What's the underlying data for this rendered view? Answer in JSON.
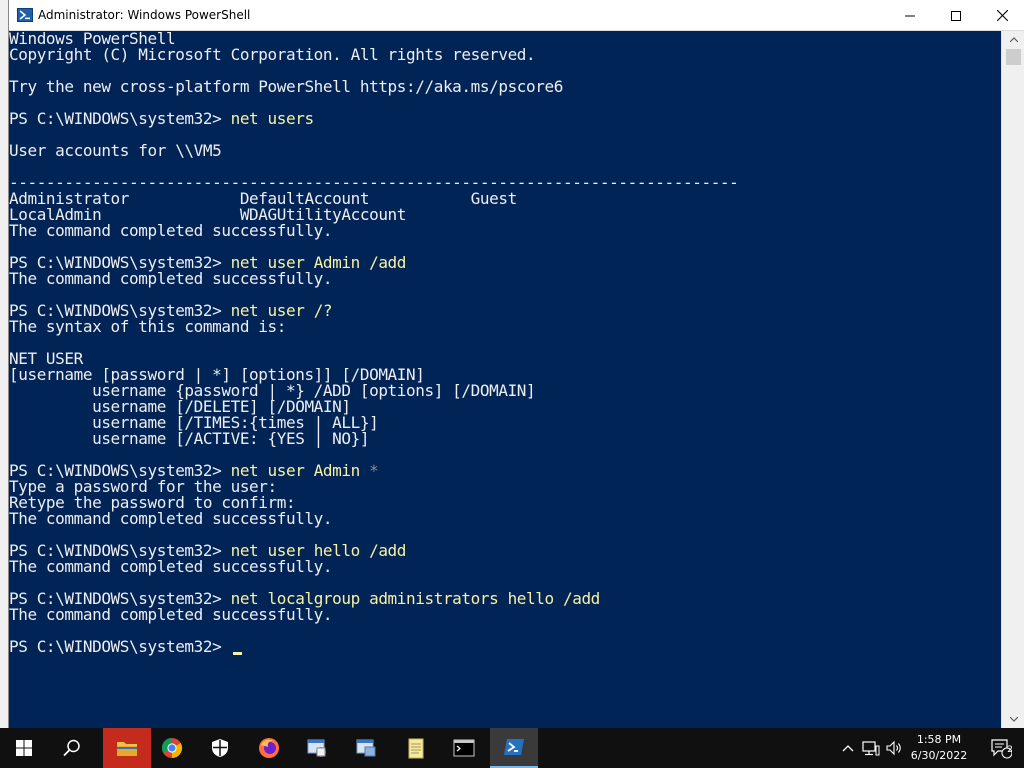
{
  "window": {
    "title": "Administrator: Windows PowerShell"
  },
  "console": {
    "lines": [
      {
        "text": "Windows PowerShell",
        "type": "output"
      },
      {
        "text": "Copyright (C) Microsoft Corporation. All rights reserved.",
        "type": "output"
      },
      {
        "text": "",
        "type": "output"
      },
      {
        "text": "Try the new cross-platform PowerShell https://aka.ms/pscore6",
        "type": "output"
      },
      {
        "text": "",
        "type": "output"
      },
      {
        "prompt": "PS C:\\WINDOWS\\system32> ",
        "command": "net users",
        "type": "command"
      },
      {
        "text": "",
        "type": "output"
      },
      {
        "text": "User accounts for \\\\VM5",
        "type": "output"
      },
      {
        "text": "",
        "type": "output"
      },
      {
        "text": "-------------------------------------------------------------------------------",
        "type": "output"
      },
      {
        "text": "Administrator            DefaultAccount           Guest",
        "type": "output"
      },
      {
        "text": "LocalAdmin               WDAGUtilityAccount",
        "type": "output"
      },
      {
        "text": "The command completed successfully.",
        "type": "output"
      },
      {
        "text": "",
        "type": "output"
      },
      {
        "prompt": "PS C:\\WINDOWS\\system32> ",
        "command": "net user Admin /add",
        "type": "command"
      },
      {
        "text": "The command completed successfully.",
        "type": "output"
      },
      {
        "text": "",
        "type": "output"
      },
      {
        "prompt": "PS C:\\WINDOWS\\system32> ",
        "command": "net user /?",
        "type": "command"
      },
      {
        "text": "The syntax of this command is:",
        "type": "output"
      },
      {
        "text": "",
        "type": "output"
      },
      {
        "text": "NET USER",
        "type": "output"
      },
      {
        "text": "[username [password | *] [options]] [/DOMAIN]",
        "type": "output"
      },
      {
        "text": "         username {password | *} /ADD [options] [/DOMAIN]",
        "type": "output"
      },
      {
        "text": "         username [/DELETE] [/DOMAIN]",
        "type": "output"
      },
      {
        "text": "         username [/TIMES:{times | ALL}]",
        "type": "output"
      },
      {
        "text": "         username [/ACTIVE: {YES | NO}]",
        "type": "output"
      },
      {
        "text": "",
        "type": "output"
      },
      {
        "prompt": "PS C:\\WINDOWS\\system32> ",
        "command": "net user Admin ",
        "arg": "*",
        "type": "command"
      },
      {
        "text": "Type a password for the user:",
        "type": "output"
      },
      {
        "text": "Retype the password to confirm:",
        "type": "output"
      },
      {
        "text": "The command completed successfully.",
        "type": "output"
      },
      {
        "text": "",
        "type": "output"
      },
      {
        "prompt": "PS C:\\WINDOWS\\system32> ",
        "command": "net user hello /add",
        "type": "command"
      },
      {
        "text": "The command completed successfully.",
        "type": "output"
      },
      {
        "text": "",
        "type": "output"
      },
      {
        "prompt": "PS C:\\WINDOWS\\system32> ",
        "command": "net localgroup administrators hello /add",
        "type": "command"
      },
      {
        "text": "The command completed successfully.",
        "type": "output"
      },
      {
        "text": "",
        "type": "output"
      },
      {
        "prompt": "PS C:\\WINDOWS\\system32> ",
        "command": "",
        "type": "prompt-current"
      }
    ]
  },
  "taskbar": {
    "items": [
      {
        "name": "start",
        "icon": "windows-logo-icon"
      },
      {
        "name": "search",
        "icon": "search-icon"
      },
      {
        "name": "file-explorer",
        "icon": "folder-icon"
      },
      {
        "name": "chrome",
        "icon": "chrome-icon"
      },
      {
        "name": "security",
        "icon": "shield-icon"
      },
      {
        "name": "firefox",
        "icon": "firefox-icon"
      },
      {
        "name": "app-1",
        "icon": "app-window-icon"
      },
      {
        "name": "app-2",
        "icon": "app-window-icon"
      },
      {
        "name": "notepad",
        "icon": "notepad-icon"
      },
      {
        "name": "command-prompt",
        "icon": "cmd-icon"
      },
      {
        "name": "powershell",
        "icon": "powershell-icon"
      }
    ],
    "clock_time": "1:58 PM",
    "clock_date": "6/30/2022",
    "notification_count": "2"
  },
  "colors": {
    "console_bg": "#012456",
    "console_fg": "#eeedf0",
    "command_fg": "#f9f1a5",
    "taskbar_bg": "#101010"
  }
}
